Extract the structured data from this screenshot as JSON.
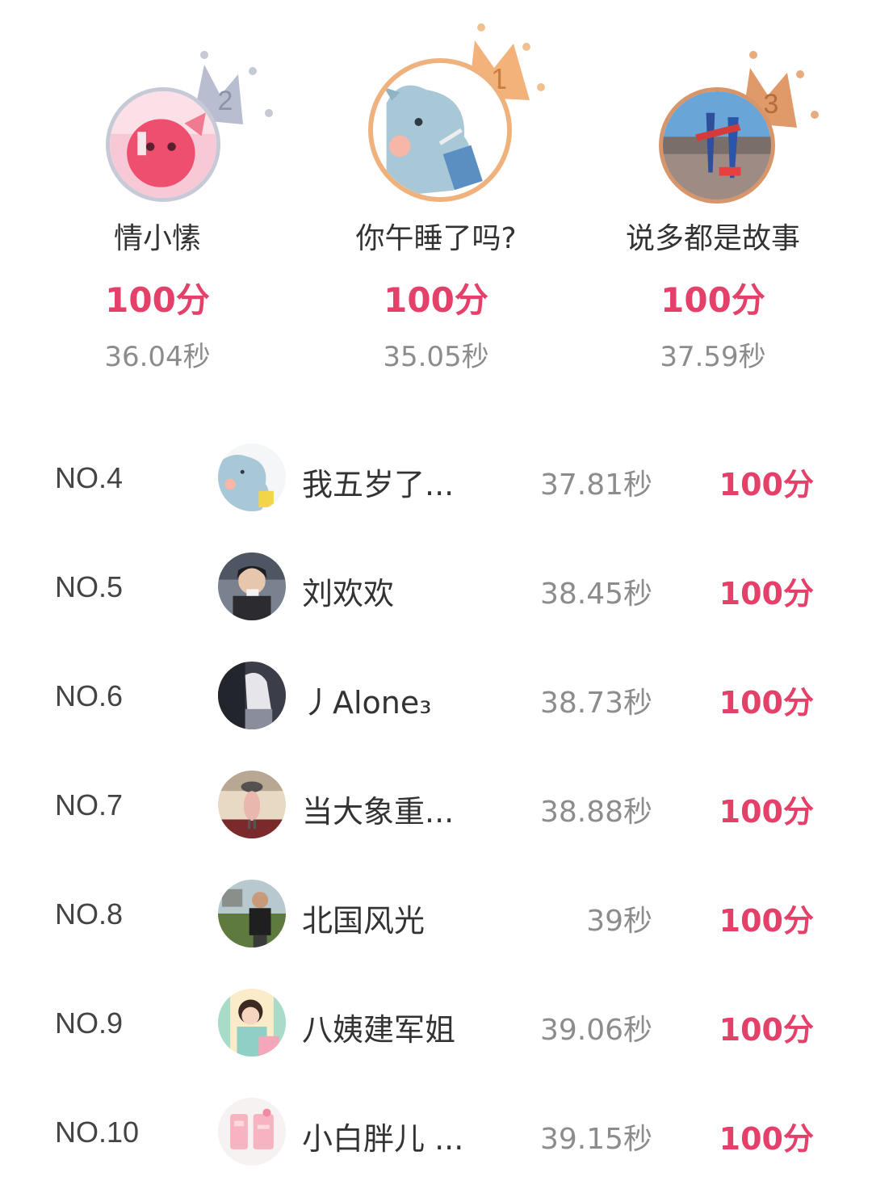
{
  "podium": {
    "second": {
      "rank": "2",
      "name": "情小愫",
      "score": "100分",
      "time": "36.04秒",
      "ring_color": "#c6c9d6",
      "crown_color": "#b8bdd0"
    },
    "first": {
      "rank": "1",
      "name": "你午睡了吗?",
      "score": "100分",
      "time": "35.05秒",
      "ring_color": "#f0b27c",
      "crown_color": "#f2b27a"
    },
    "third": {
      "rank": "3",
      "name": "说多都是故事",
      "score": "100分",
      "time": "37.59秒",
      "ring_color": "#d9956a",
      "crown_color": "#e09a6a"
    }
  },
  "ranking": [
    {
      "no": "NO.4",
      "name": "我五岁了...",
      "time": "37.81秒",
      "score": "100分"
    },
    {
      "no": "NO.5",
      "name": "刘欢欢",
      "time": "38.45秒",
      "score": "100分"
    },
    {
      "no": "NO.6",
      "name": "丿Alone₃",
      "time": "38.73秒",
      "score": "100分"
    },
    {
      "no": "NO.7",
      "name": "当大象重...",
      "time": "38.88秒",
      "score": "100分"
    },
    {
      "no": "NO.8",
      "name": "北国风光",
      "time": "39秒",
      "score": "100分"
    },
    {
      "no": "NO.9",
      "name": "八姨建军姐",
      "time": "39.06秒",
      "score": "100分"
    },
    {
      "no": "NO.10",
      "name": "小白胖儿 ...",
      "time": "39.15秒",
      "score": "100分"
    }
  ],
  "colors": {
    "score": "#e5406a",
    "time": "#8c8c8c",
    "text": "#333333"
  }
}
